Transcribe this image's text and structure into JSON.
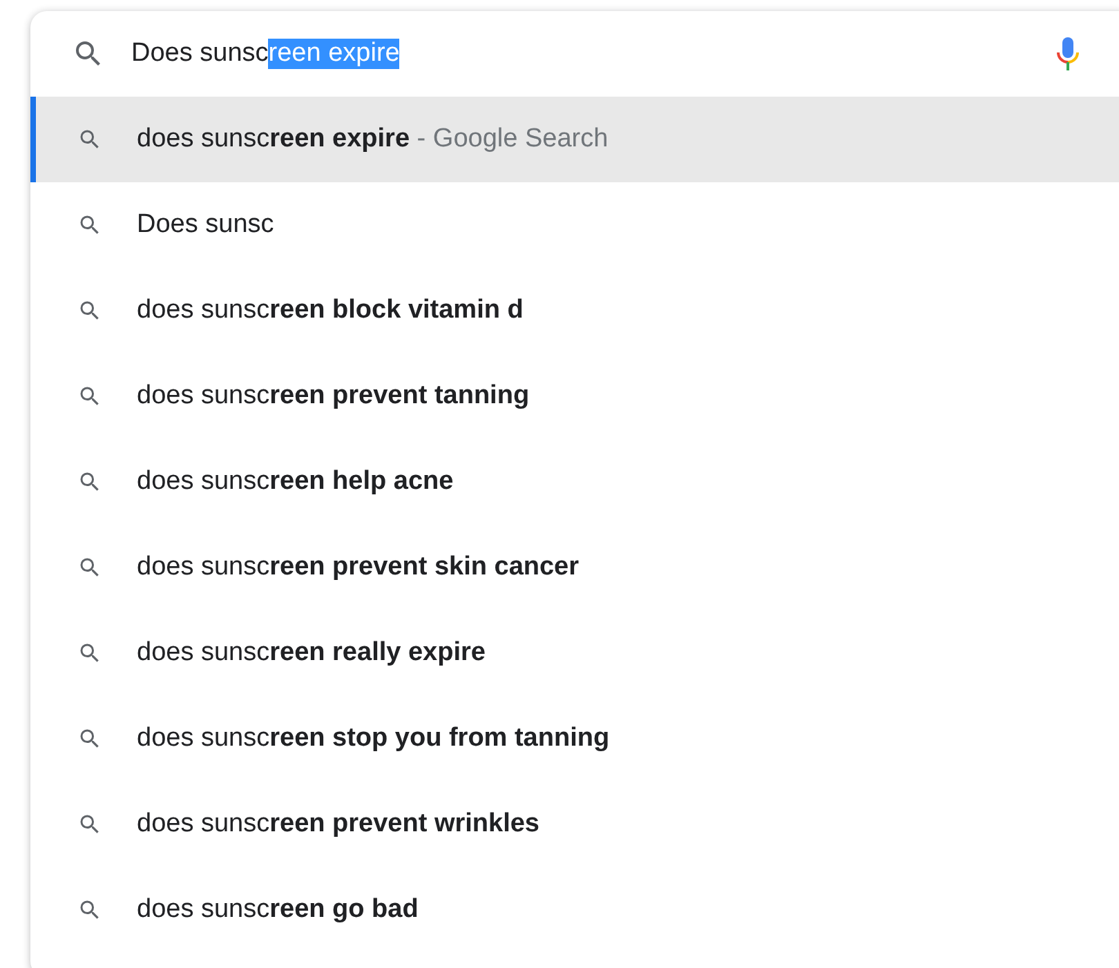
{
  "search": {
    "text": "Does sunsc",
    "selection": "reen expire"
  },
  "suggestions": [
    {
      "text": "does sunsc**reen expire**",
      "suffix": " - Google Search",
      "selected": true
    },
    {
      "text": "Does sunsc",
      "selected": false
    },
    {
      "text": "does sunsc**reen block vitamin d**",
      "selected": false
    },
    {
      "text": "does sunsc**reen prevent tanning**",
      "selected": false
    },
    {
      "text": "does sunsc**reen help acne**",
      "selected": false
    },
    {
      "text": "does sunsc**reen prevent skin cancer**",
      "selected": false
    },
    {
      "text": "does sunsc**reen really expire**",
      "selected": false
    },
    {
      "text": "does sunsc**reen stop you from tanning**",
      "selected": false
    },
    {
      "text": "does sunsc**reen prevent wrinkles**",
      "selected": false
    },
    {
      "text": "does sunsc**reen go bad**",
      "selected": false
    }
  ]
}
